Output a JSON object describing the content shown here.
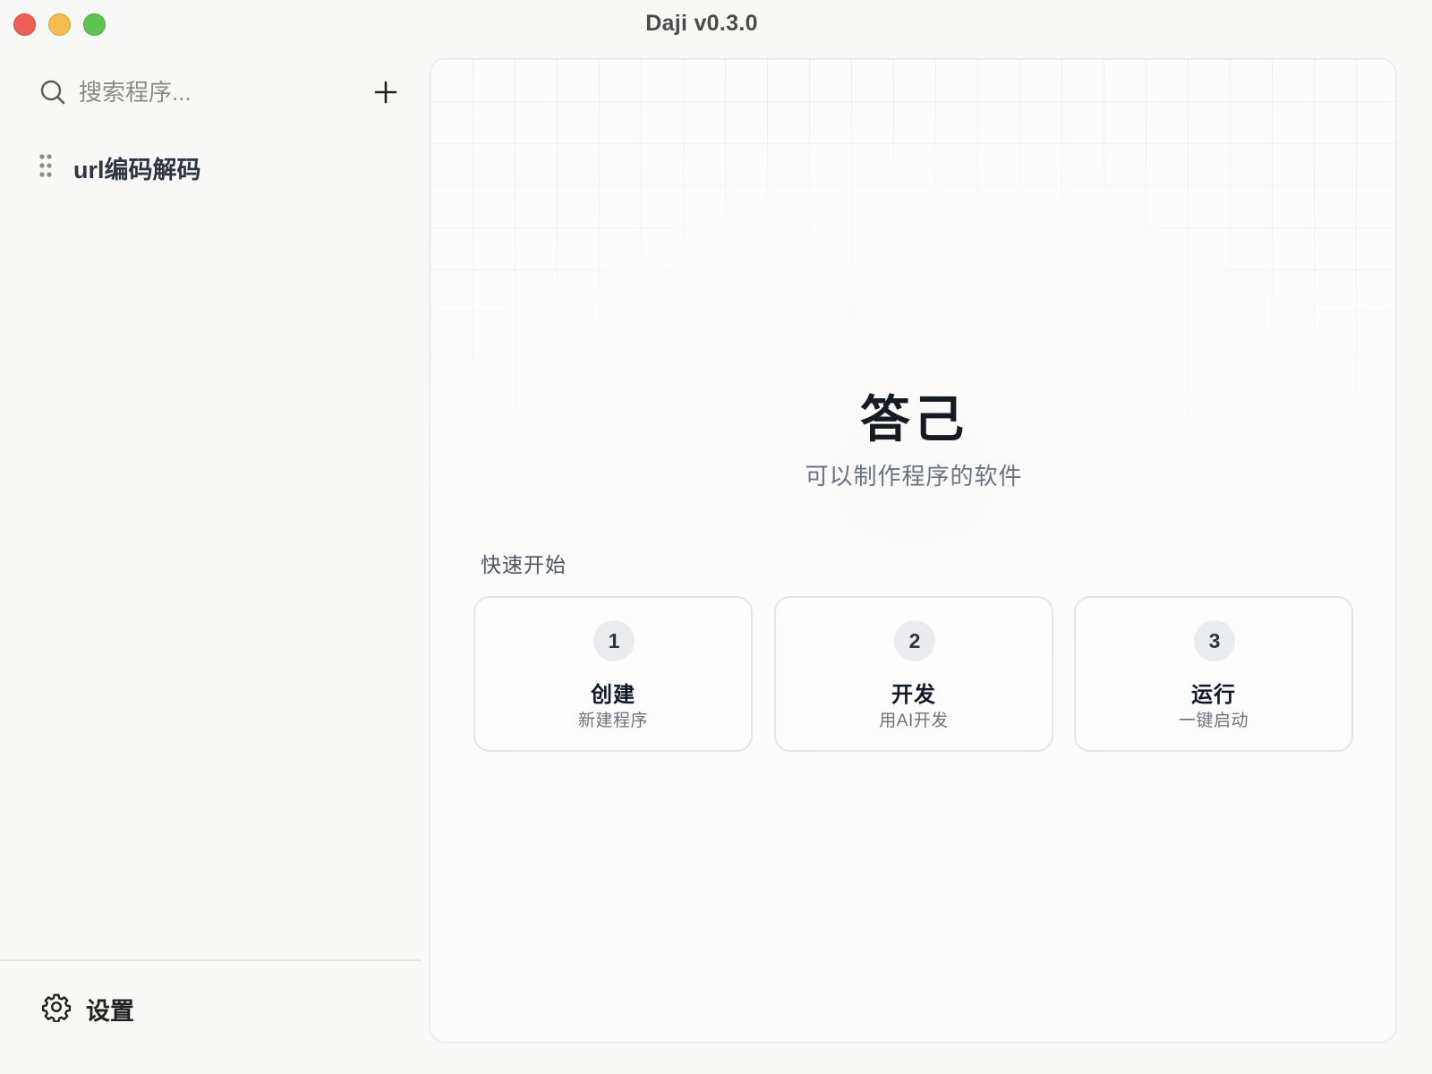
{
  "window": {
    "title": "Daji  v0.3.0",
    "traffic_lights": {
      "close": "#ee5f56",
      "minimize": "#f5bd4f",
      "maximize": "#5fc453"
    }
  },
  "sidebar": {
    "search": {
      "placeholder": "搜索程序...",
      "value": "",
      "icon": "search-icon"
    },
    "add_icon": "plus-icon",
    "programs": [
      {
        "label": "url编码解码",
        "icon": "drag-handle-icon"
      }
    ],
    "settings": {
      "label": "设置",
      "icon": "gear-icon"
    }
  },
  "main": {
    "title": "答己",
    "subtitle": "可以制作程序的软件",
    "quickstart": {
      "heading": "快速开始",
      "cards": [
        {
          "number": "1",
          "title": "创建",
          "desc": "新建程序"
        },
        {
          "number": "2",
          "title": "开发",
          "desc": "用AI开发"
        },
        {
          "number": "3",
          "title": "运行",
          "desc": "一键启动"
        }
      ]
    }
  }
}
